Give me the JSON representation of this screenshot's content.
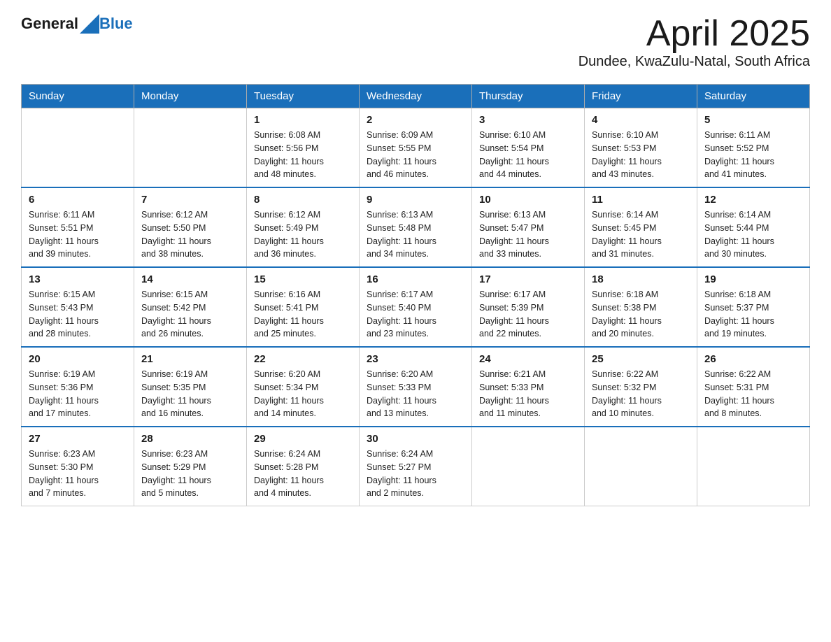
{
  "header": {
    "logo_general": "General",
    "logo_blue": "Blue",
    "title": "April 2025",
    "subtitle": "Dundee, KwaZulu-Natal, South Africa"
  },
  "calendar": {
    "days_of_week": [
      "Sunday",
      "Monday",
      "Tuesday",
      "Wednesday",
      "Thursday",
      "Friday",
      "Saturday"
    ],
    "weeks": [
      [
        {
          "day": "",
          "info": ""
        },
        {
          "day": "",
          "info": ""
        },
        {
          "day": "1",
          "info": "Sunrise: 6:08 AM\nSunset: 5:56 PM\nDaylight: 11 hours\nand 48 minutes."
        },
        {
          "day": "2",
          "info": "Sunrise: 6:09 AM\nSunset: 5:55 PM\nDaylight: 11 hours\nand 46 minutes."
        },
        {
          "day": "3",
          "info": "Sunrise: 6:10 AM\nSunset: 5:54 PM\nDaylight: 11 hours\nand 44 minutes."
        },
        {
          "day": "4",
          "info": "Sunrise: 6:10 AM\nSunset: 5:53 PM\nDaylight: 11 hours\nand 43 minutes."
        },
        {
          "day": "5",
          "info": "Sunrise: 6:11 AM\nSunset: 5:52 PM\nDaylight: 11 hours\nand 41 minutes."
        }
      ],
      [
        {
          "day": "6",
          "info": "Sunrise: 6:11 AM\nSunset: 5:51 PM\nDaylight: 11 hours\nand 39 minutes."
        },
        {
          "day": "7",
          "info": "Sunrise: 6:12 AM\nSunset: 5:50 PM\nDaylight: 11 hours\nand 38 minutes."
        },
        {
          "day": "8",
          "info": "Sunrise: 6:12 AM\nSunset: 5:49 PM\nDaylight: 11 hours\nand 36 minutes."
        },
        {
          "day": "9",
          "info": "Sunrise: 6:13 AM\nSunset: 5:48 PM\nDaylight: 11 hours\nand 34 minutes."
        },
        {
          "day": "10",
          "info": "Sunrise: 6:13 AM\nSunset: 5:47 PM\nDaylight: 11 hours\nand 33 minutes."
        },
        {
          "day": "11",
          "info": "Sunrise: 6:14 AM\nSunset: 5:45 PM\nDaylight: 11 hours\nand 31 minutes."
        },
        {
          "day": "12",
          "info": "Sunrise: 6:14 AM\nSunset: 5:44 PM\nDaylight: 11 hours\nand 30 minutes."
        }
      ],
      [
        {
          "day": "13",
          "info": "Sunrise: 6:15 AM\nSunset: 5:43 PM\nDaylight: 11 hours\nand 28 minutes."
        },
        {
          "day": "14",
          "info": "Sunrise: 6:15 AM\nSunset: 5:42 PM\nDaylight: 11 hours\nand 26 minutes."
        },
        {
          "day": "15",
          "info": "Sunrise: 6:16 AM\nSunset: 5:41 PM\nDaylight: 11 hours\nand 25 minutes."
        },
        {
          "day": "16",
          "info": "Sunrise: 6:17 AM\nSunset: 5:40 PM\nDaylight: 11 hours\nand 23 minutes."
        },
        {
          "day": "17",
          "info": "Sunrise: 6:17 AM\nSunset: 5:39 PM\nDaylight: 11 hours\nand 22 minutes."
        },
        {
          "day": "18",
          "info": "Sunrise: 6:18 AM\nSunset: 5:38 PM\nDaylight: 11 hours\nand 20 minutes."
        },
        {
          "day": "19",
          "info": "Sunrise: 6:18 AM\nSunset: 5:37 PM\nDaylight: 11 hours\nand 19 minutes."
        }
      ],
      [
        {
          "day": "20",
          "info": "Sunrise: 6:19 AM\nSunset: 5:36 PM\nDaylight: 11 hours\nand 17 minutes."
        },
        {
          "day": "21",
          "info": "Sunrise: 6:19 AM\nSunset: 5:35 PM\nDaylight: 11 hours\nand 16 minutes."
        },
        {
          "day": "22",
          "info": "Sunrise: 6:20 AM\nSunset: 5:34 PM\nDaylight: 11 hours\nand 14 minutes."
        },
        {
          "day": "23",
          "info": "Sunrise: 6:20 AM\nSunset: 5:33 PM\nDaylight: 11 hours\nand 13 minutes."
        },
        {
          "day": "24",
          "info": "Sunrise: 6:21 AM\nSunset: 5:33 PM\nDaylight: 11 hours\nand 11 minutes."
        },
        {
          "day": "25",
          "info": "Sunrise: 6:22 AM\nSunset: 5:32 PM\nDaylight: 11 hours\nand 10 minutes."
        },
        {
          "day": "26",
          "info": "Sunrise: 6:22 AM\nSunset: 5:31 PM\nDaylight: 11 hours\nand 8 minutes."
        }
      ],
      [
        {
          "day": "27",
          "info": "Sunrise: 6:23 AM\nSunset: 5:30 PM\nDaylight: 11 hours\nand 7 minutes."
        },
        {
          "day": "28",
          "info": "Sunrise: 6:23 AM\nSunset: 5:29 PM\nDaylight: 11 hours\nand 5 minutes."
        },
        {
          "day": "29",
          "info": "Sunrise: 6:24 AM\nSunset: 5:28 PM\nDaylight: 11 hours\nand 4 minutes."
        },
        {
          "day": "30",
          "info": "Sunrise: 6:24 AM\nSunset: 5:27 PM\nDaylight: 11 hours\nand 2 minutes."
        },
        {
          "day": "",
          "info": ""
        },
        {
          "day": "",
          "info": ""
        },
        {
          "day": "",
          "info": ""
        }
      ]
    ]
  }
}
